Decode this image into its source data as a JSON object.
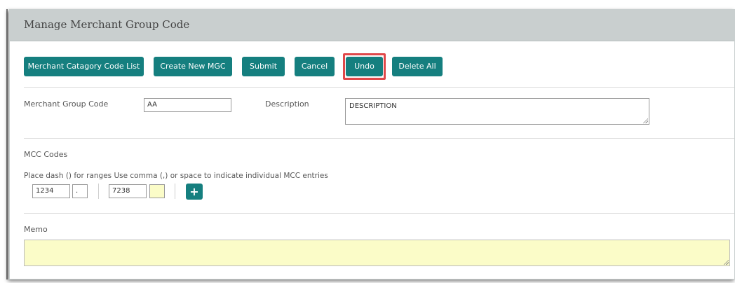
{
  "header": {
    "title": "Manage Merchant Group Code"
  },
  "toolbar": {
    "mcc_list_label": "Merchant Catagory Code List",
    "create_label": "Create New MGC",
    "submit_label": "Submit",
    "cancel_label": "Cancel",
    "undo_label": "Undo",
    "delete_all_label": "Delete All"
  },
  "form": {
    "mgc_label": "Merchant Group Code",
    "mgc_value": "AA",
    "description_label": "Description",
    "description_value": "DESCRIPTION"
  },
  "mcc": {
    "section_label": "MCC Codes",
    "hint": "Place dash () for ranges Use comma (,) or space to indicate individual MCC entries",
    "entry_start": "1234",
    "entry_separator": ".",
    "entry_end": "7238",
    "entry_extra": "",
    "add_icon": "plus-icon",
    "add_symbol": "+"
  },
  "memo": {
    "label": "Memo",
    "value": ""
  },
  "colors": {
    "accent": "#157f7f",
    "header_bg": "#c9cfcf",
    "highlight_border": "#e0484a",
    "field_yellow": "#fbfcc8"
  }
}
